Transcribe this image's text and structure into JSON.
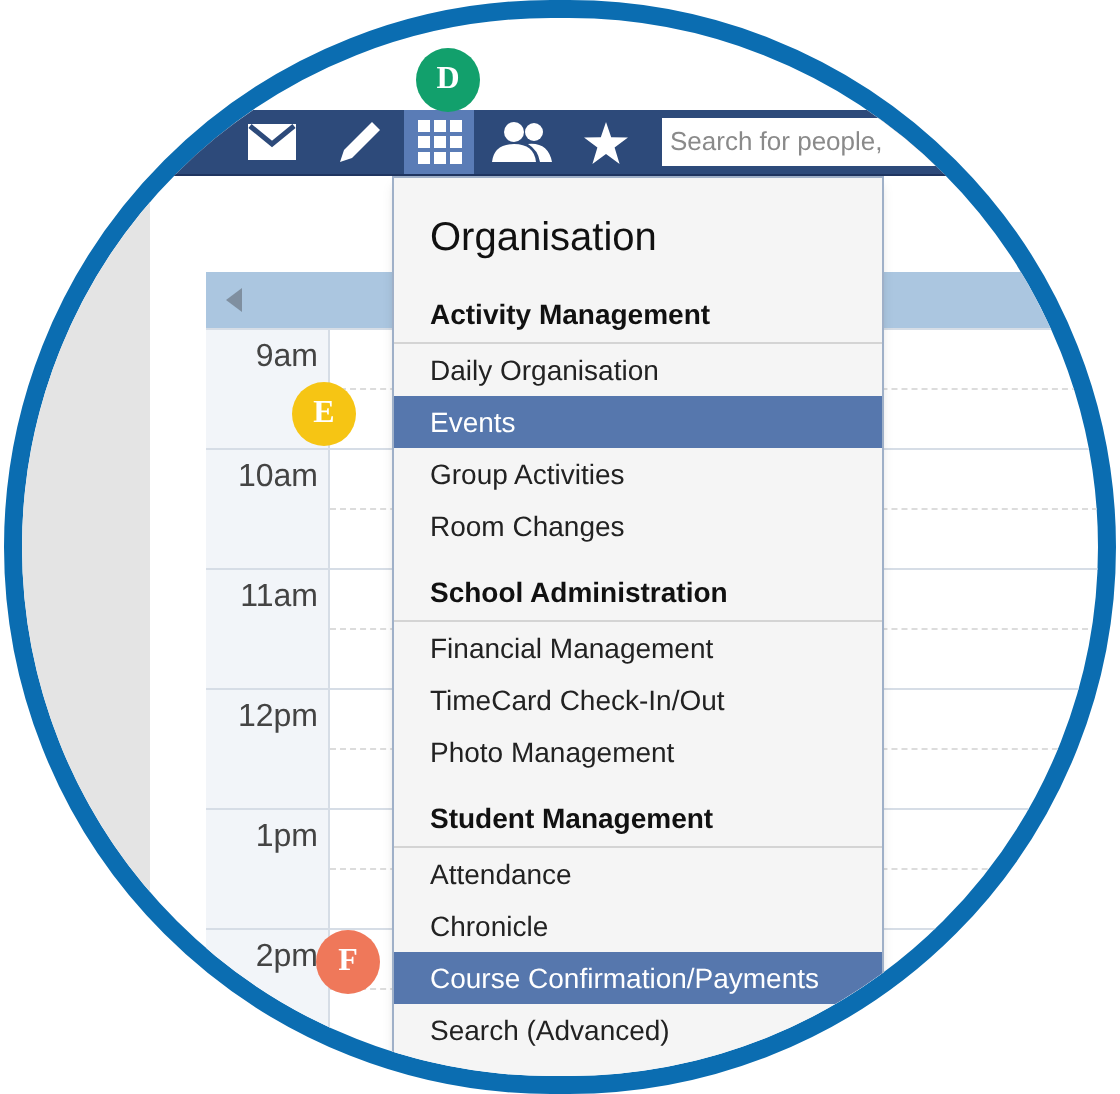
{
  "callouts": [
    {
      "label": "D",
      "color": "#12a06c"
    },
    {
      "label": "E",
      "color": "#f6c514"
    },
    {
      "label": "F",
      "color": "#ef785a"
    }
  ],
  "toolbar": {
    "icons": [
      {
        "kind": "mail",
        "selected": false
      },
      {
        "kind": "pencil",
        "selected": false
      },
      {
        "kind": "grid",
        "selected": true
      },
      {
        "kind": "people",
        "selected": false
      },
      {
        "kind": "star",
        "selected": false
      }
    ],
    "search": {
      "placeholder": "Search for people,"
    }
  },
  "calendar": {
    "hours": [
      "9am",
      "10am",
      "11am",
      "12pm",
      "1pm",
      "2pm"
    ]
  },
  "menu": {
    "title": "Organisation",
    "sections": [
      {
        "heading": "Activity Management",
        "items": [
          {
            "label": "Daily Organisation",
            "selected": false
          },
          {
            "label": "Events",
            "selected": true
          },
          {
            "label": "Group Activities",
            "selected": false
          },
          {
            "label": "Room Changes",
            "selected": false
          }
        ]
      },
      {
        "heading": "School Administration",
        "items": [
          {
            "label": "Financial Management",
            "selected": false
          },
          {
            "label": "TimeCard Check-In/Out",
            "selected": false
          },
          {
            "label": "Photo Management",
            "selected": false
          }
        ]
      },
      {
        "heading": "Student Management",
        "items": [
          {
            "label": "Attendance",
            "selected": false
          },
          {
            "label": "Chronicle",
            "selected": false
          },
          {
            "label": "Course Confirmation/Payments",
            "selected": true
          },
          {
            "label": "Search (Advanced)",
            "selected": false
          }
        ]
      }
    ]
  }
}
